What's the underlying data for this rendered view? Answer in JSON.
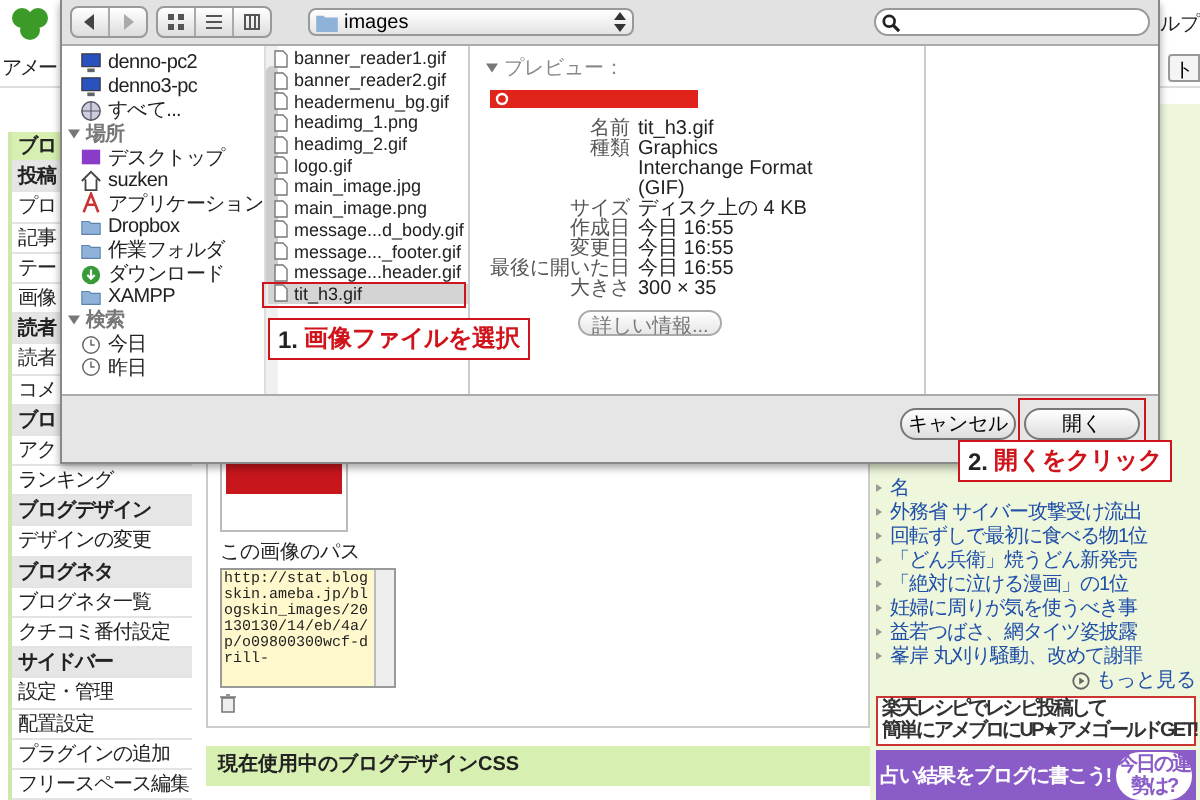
{
  "page": {
    "header": {
      "nav": [
        "ルプ"
      ],
      "subnav": "アメー",
      "button": "ト"
    },
    "sidebar": [
      {
        "kind": "heading-main",
        "label": "ブロ"
      },
      {
        "kind": "heading",
        "label": "投稿"
      },
      {
        "kind": "item",
        "label": "プロ"
      },
      {
        "kind": "item",
        "label": "記事"
      },
      {
        "kind": "item",
        "label": "テー"
      },
      {
        "kind": "item",
        "label": "画像"
      },
      {
        "kind": "heading",
        "label": "読者"
      },
      {
        "kind": "item",
        "label": "読者"
      },
      {
        "kind": "item",
        "label": "コメ"
      },
      {
        "kind": "heading",
        "label": "ブロ"
      },
      {
        "kind": "item",
        "label": "アク"
      },
      {
        "kind": "item",
        "label": "ランキング"
      },
      {
        "kind": "heading",
        "label": "ブログデザイン"
      },
      {
        "kind": "item",
        "label": "デザインの変更"
      },
      {
        "kind": "heading",
        "label": "ブログネタ"
      },
      {
        "kind": "item",
        "label": "ブログネタ一覧"
      },
      {
        "kind": "item",
        "label": "クチコミ番付設定"
      },
      {
        "kind": "heading",
        "label": "サイドバー"
      },
      {
        "kind": "item",
        "label": "設定・管理"
      },
      {
        "kind": "item",
        "label": "配置設定"
      },
      {
        "kind": "item",
        "label": "プラグインの追加"
      },
      {
        "kind": "item",
        "label": "フリースペース編集"
      }
    ],
    "main": {
      "path_label": "この画像のパス",
      "path_value": "http://stat.blogskin.ameba.jp/blogskin_images/20130130/14/eb/4a/p/o09800300wcf-drill-",
      "css_heading": "現在使用中のブログデザインCSS"
    },
    "news": [
      "名",
      "外務省 サイバー攻撃受け流出",
      "回転ずしで最初に食べる物1位",
      "「どん兵衛」焼うどん新発売",
      "「絶対に泣ける漫画」の1位",
      "妊婦に周りが気を使うべき事",
      "益若つばさ、網タイツ姿披露",
      "峯岸 丸刈り騒動、改めて謝罪"
    ],
    "more_link": "もっと見る",
    "banners": [
      {
        "kind": "recipe",
        "lines": [
          "楽天レシピでレシピ投稿して",
          "簡単にアメブロにUP★アメゴールドGET!"
        ]
      },
      {
        "kind": "fortune",
        "lines": [
          "占い結果をブログに書こう!",
          "今日の運勢は?"
        ]
      }
    ]
  },
  "dialog": {
    "location": "images",
    "sidebar": [
      {
        "kind": "computer",
        "label": "denno-pc2"
      },
      {
        "kind": "computer",
        "label": "denno3-pc"
      },
      {
        "kind": "network",
        "label": "すべて..."
      },
      {
        "kind": "heading",
        "label": "場所",
        "expanded": true
      },
      {
        "kind": "desktop",
        "label": "デスクトップ"
      },
      {
        "kind": "home",
        "label": "suzken"
      },
      {
        "kind": "apps",
        "label": "アプリケーション"
      },
      {
        "kind": "folder",
        "label": "Dropbox"
      },
      {
        "kind": "folder",
        "label": "作業フォルダ"
      },
      {
        "kind": "download",
        "label": "ダウンロード"
      },
      {
        "kind": "folder",
        "label": "XAMPP"
      },
      {
        "kind": "heading",
        "label": "検索",
        "expanded": true
      },
      {
        "kind": "clock",
        "label": "今日"
      },
      {
        "kind": "clock",
        "label": "昨日"
      }
    ],
    "files": [
      {
        "name": "banner_reader1.gif",
        "selected": false
      },
      {
        "name": "banner_reader2.gif",
        "selected": false
      },
      {
        "name": "headermenu_bg.gif",
        "selected": false
      },
      {
        "name": "headimg_1.png",
        "selected": false
      },
      {
        "name": "headimg_2.gif",
        "selected": false
      },
      {
        "name": "logo.gif",
        "selected": false
      },
      {
        "name": "main_image.jpg",
        "selected": false
      },
      {
        "name": "main_image.png",
        "selected": false
      },
      {
        "name": "message...d_body.gif",
        "selected": false
      },
      {
        "name": "message..._footer.gif",
        "selected": false
      },
      {
        "name": "message...header.gif",
        "selected": false
      },
      {
        "name": "tit_h3.gif",
        "selected": true
      }
    ],
    "preview": {
      "heading": "プレビュー：",
      "expanded": true,
      "fields": [
        {
          "label": "名前",
          "value": "tit_h3.gif"
        },
        {
          "label": "種類",
          "value": "Graphics Interchange Format (GIF)"
        },
        {
          "label": "サイズ",
          "value": "ディスク上の 4 KB"
        },
        {
          "label": "作成日",
          "value": "今日 16:55"
        },
        {
          "label": "変更日",
          "value": "今日 16:55"
        },
        {
          "label": "最後に開いた日",
          "value": "今日 16:55"
        },
        {
          "label": "大きさ",
          "value": "300 × 35"
        }
      ],
      "more_button": "詳しい情報..."
    },
    "buttons": [
      "キャンセル",
      "開く"
    ]
  },
  "annotations": [
    {
      "number": "1.",
      "text": "画像ファイルを選択"
    },
    {
      "number": "2.",
      "text": "開くをクリック"
    }
  ]
}
